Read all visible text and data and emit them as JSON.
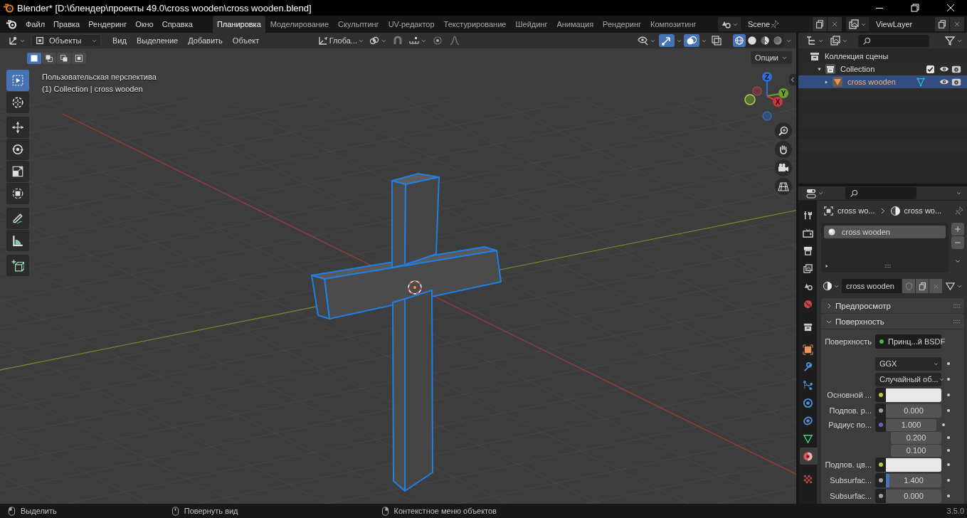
{
  "window": {
    "title": "Blender* [D:\\блендер\\проекты 49.0\\cross wooden\\cross wooden.blend]"
  },
  "menu": [
    "Файл",
    "Правка",
    "Рендеринг",
    "Окно",
    "Справка"
  ],
  "workspaces": [
    {
      "label": "Планировка",
      "selected": true
    },
    {
      "label": "Моделирование",
      "selected": false
    },
    {
      "label": "Скульптинг",
      "selected": false
    },
    {
      "label": "UV-редактор",
      "selected": false
    },
    {
      "label": "Текстурирование",
      "selected": false
    },
    {
      "label": "Шейдинг",
      "selected": false
    },
    {
      "label": "Анимация",
      "selected": false
    },
    {
      "label": "Рендеринг",
      "selected": false
    },
    {
      "label": "Композитинг",
      "selected": false
    }
  ],
  "scene": "Scene",
  "view_layer": "ViewLayer",
  "viewport": {
    "mode": "Объекты",
    "menus": [
      "Вид",
      "Выделение",
      "Добавить",
      "Объект"
    ],
    "orientation": "Глоба...",
    "gizmos": {
      "on": true
    },
    "overlays": {
      "on": true
    },
    "xray": {
      "on": false
    },
    "shading": [
      {
        "selected": true
      },
      {
        "selected": false
      },
      {
        "selected": false
      },
      {
        "selected": false
      }
    ],
    "select_modes": [
      {
        "selected": true
      },
      {
        "selected": false
      },
      {
        "selected": false
      },
      {
        "selected": false
      }
    ],
    "options": "Опции",
    "view_name": "Пользовательская перспектива",
    "info": "(1) Collection | cross wooden",
    "tool_groups": [
      {
        "tools": [
          {
            "selected": true
          },
          {
            "selected": false
          }
        ]
      },
      {
        "tools": [
          {
            "selected": false
          },
          {
            "selected": false
          },
          {
            "selected": false
          },
          {
            "selected": false
          }
        ]
      },
      {
        "tools": [
          {
            "selected": false
          },
          {
            "selected": false
          }
        ]
      },
      {
        "tools": [
          {
            "selected": false
          }
        ]
      }
    ],
    "gizmo_labels": [
      "Z",
      "Y",
      "X"
    ]
  },
  "outliner": {
    "items": [
      {
        "kind": "scene_collection",
        "label": "Коллекция сцены",
        "selected": false,
        "children": [
          {
            "kind": "collection",
            "label": "Collection",
            "selected": false,
            "expanded": true,
            "checked": true,
            "children": [
              {
                "kind": "object",
                "label": "cross wooden",
                "selected": true,
                "expanded": false
              }
            ]
          }
        ]
      }
    ]
  },
  "properties": {
    "tabs": [
      {
        "selected": false
      },
      {
        "selected": false
      },
      {
        "selected": false
      },
      {
        "selected": false
      },
      {
        "selected": false
      },
      {
        "selected": false
      },
      {
        "selected": false
      },
      {
        "selected": false
      },
      {
        "selected": false
      },
      {
        "selected": false
      },
      {
        "selected": false
      },
      {
        "selected": false
      },
      {
        "selected": false
      },
      {
        "selected": true
      },
      {
        "selected": false
      }
    ],
    "breadcrumb": [
      "cross wo...",
      "cross wo..."
    ],
    "slots": [
      {
        "label": "cross wooden",
        "selected": true
      }
    ],
    "material": "cross wooden",
    "panels": [
      {
        "title": "Предпросмотр",
        "expanded": false
      },
      {
        "title": "Поверхность",
        "expanded": true
      }
    ],
    "fields": [
      {
        "kind": "socket",
        "label": "Поверхность",
        "value": "Принц...й BSDF",
        "socket": {
          "color": "#4ab54a"
        }
      },
      {
        "kind": "dropdown",
        "value": "GGX"
      },
      {
        "kind": "dropdown",
        "value": "Случайный об..."
      },
      {
        "kind": "color",
        "label": "Основной ...",
        "socket": {
          "color": "#c8c83c"
        },
        "color": "#e8e8e8"
      },
      {
        "kind": "number",
        "label": "Подпов. р...",
        "socket": {
          "color": "#a1a1a1"
        },
        "value": "0.000"
      },
      {
        "kind": "vector",
        "label": "Радиус по...",
        "socket": {
          "color": "#6363c7"
        },
        "values": [
          "1.000",
          "0.200",
          "0.100"
        ]
      },
      {
        "kind": "color",
        "label": "Подпов. цв...",
        "socket": {
          "color": "#c8c83c"
        },
        "color": "#e8e8e8"
      },
      {
        "kind": "slider",
        "label": "Subsurfac...",
        "socket": {
          "color": "#a1a1a1"
        },
        "value": "1.400",
        "level": 0.07
      },
      {
        "kind": "number",
        "label": "Subsurfac...",
        "socket": {
          "color": "#a1a1a1"
        },
        "value": "0.000"
      }
    ]
  },
  "status_bar": {
    "items": [
      "Выделить",
      "Повернуть вид",
      "Контекстное меню объектов"
    ],
    "version": "3.5.0"
  }
}
